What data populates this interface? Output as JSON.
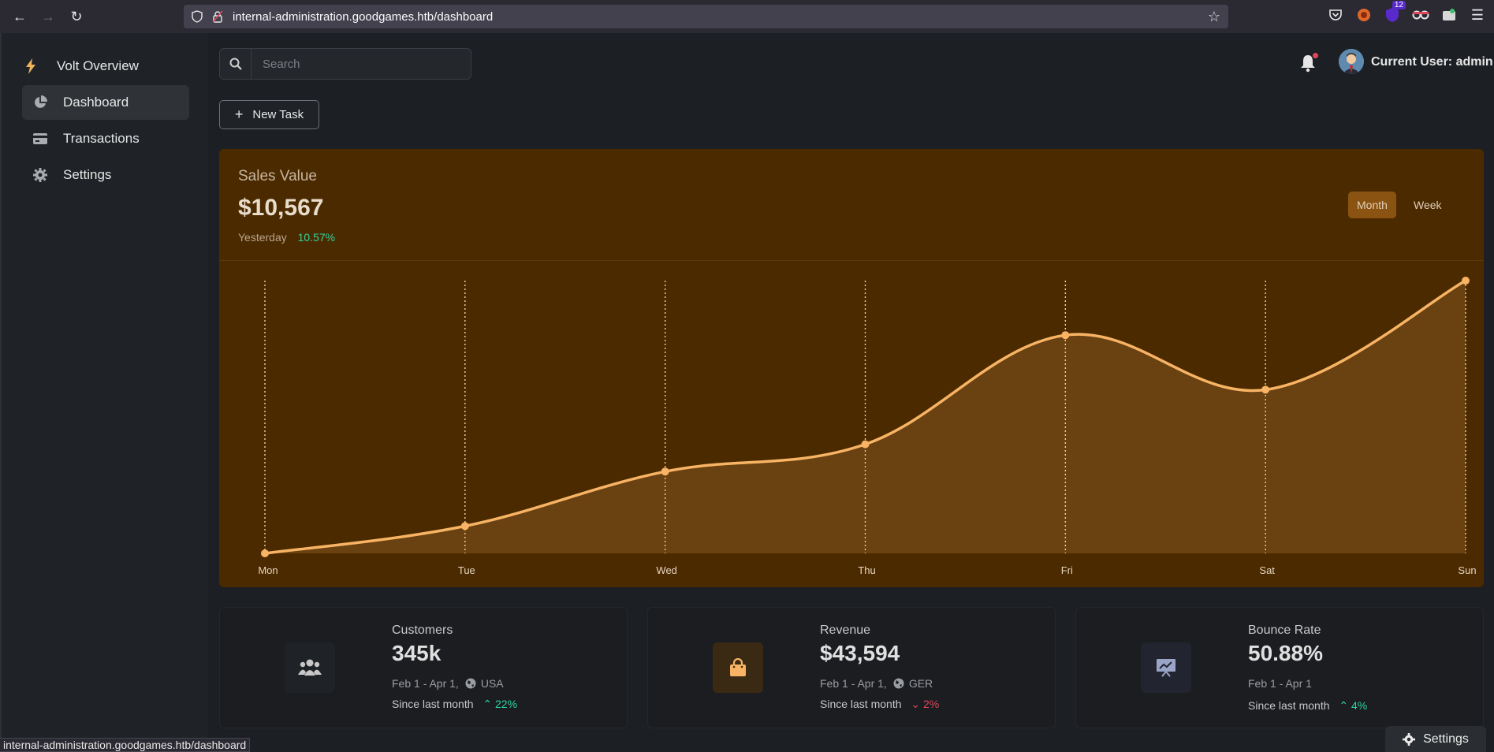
{
  "browser": {
    "url": "internal-administration.goodgames.htb/dashboard",
    "extension_badge": "12",
    "status_url": "internal-administration.goodgames.htb/dashboard"
  },
  "sidebar": {
    "brand": "Volt Overview",
    "items": [
      {
        "label": "Dashboard",
        "icon": "pie-chart-icon",
        "active": true
      },
      {
        "label": "Transactions",
        "icon": "credit-card-icon",
        "active": false
      },
      {
        "label": "Settings",
        "icon": "gear-icon",
        "active": false
      }
    ]
  },
  "topbar": {
    "search_placeholder": "Search",
    "user_label": "Current User: admin"
  },
  "actions": {
    "new_task": "New Task"
  },
  "sales": {
    "title": "Sales Value",
    "value": "$10,567",
    "period_label": "Yesterday",
    "change": "10.57%",
    "toggle_month": "Month",
    "toggle_week": "Week"
  },
  "chart_data": {
    "type": "area",
    "categories": [
      "Mon",
      "Tue",
      "Wed",
      "Thu",
      "Fri",
      "Sat",
      "Sun"
    ],
    "values": [
      0,
      10,
      30,
      40,
      80,
      60,
      100
    ],
    "ylim": [
      0,
      100
    ],
    "grid": "vertical-dotted",
    "color": "#f8b464"
  },
  "stats": [
    {
      "title": "Customers",
      "value": "345k",
      "range": "Feb 1 - Apr 1,",
      "region": "USA",
      "since": "Since last month",
      "change": "22%",
      "direction": "up",
      "icon": "users-icon",
      "icon_color": "#c8c8c8",
      "icon_bg": "#1f2226"
    },
    {
      "title": "Revenue",
      "value": "$43,594",
      "range": "Feb 1 - Apr 1,",
      "region": "GER",
      "since": "Since last month",
      "change": "2%",
      "direction": "down",
      "icon": "shopping-bag-icon",
      "icon_color": "#f8b464",
      "icon_bg": "#3a2a14"
    },
    {
      "title": "Bounce Rate",
      "value": "50.88%",
      "range": "Feb 1 - Apr 1",
      "region": "",
      "since": "Since last month",
      "change": "4%",
      "direction": "up",
      "icon": "presentation-chart-icon",
      "icon_color": "#9aa4c8",
      "icon_bg": "#22252f"
    }
  ],
  "settings_fab": "Settings"
}
